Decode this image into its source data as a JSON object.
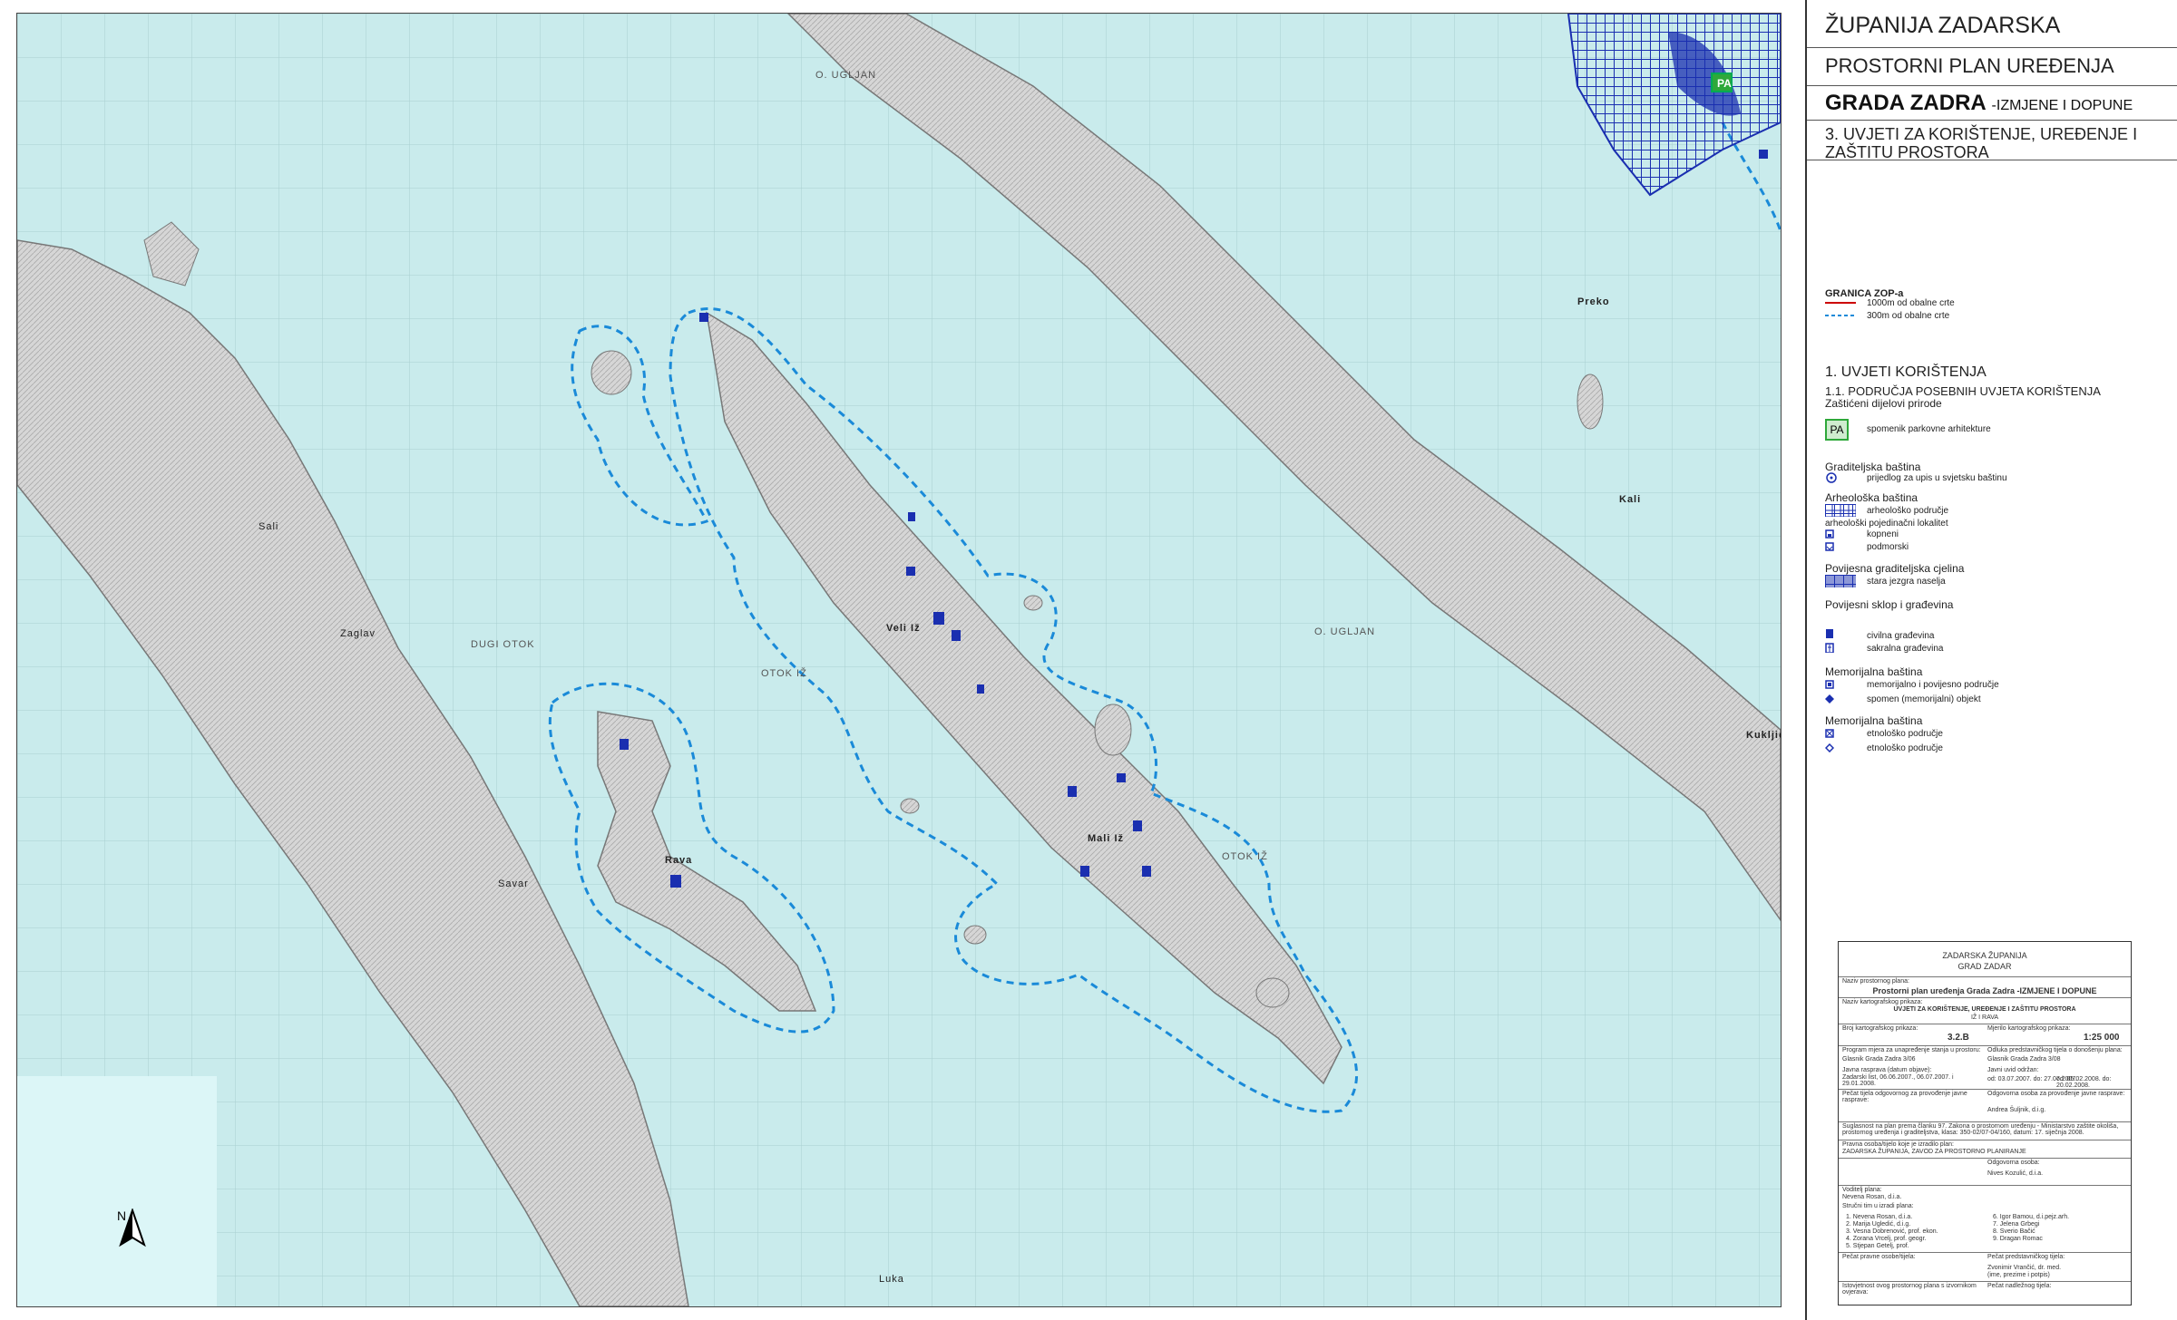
{
  "header": {
    "county": "ŽUPANIJA ZADARSKA",
    "plan": "PROSTORNI PLAN UREĐENJA",
    "city": "GRADA ZADRA",
    "suffix": "-IZMJENE I DOPUNE",
    "sheet_title": "3. UVJETI ZA KORIŠTENJE, UREĐENJE I ZAŠTITU PROSTORA"
  },
  "legend": {
    "zop_title": "GRANICA ZOP-a",
    "zop_1000": "1000m od obalne crte",
    "zop_300": "300m od obalne crte",
    "sec1": "1. UVJETI KORIŠTENJA",
    "sec11": "1.1. PODRUČJA POSEBNIH UVJETA KORIŠTENJA",
    "sec11b": "Zaštićeni dijelovi prirode",
    "pa_code": "PA",
    "pa_label": "spomenik parkovne arhitekture",
    "grad_head": "Graditeljska baština",
    "grad_item": "prijedlog za upis u svjetsku baštinu",
    "arh_head": "Arheološka baština",
    "arh_area": "arheološko područje",
    "arh_sites": "arheološki pojedinačni lokalitet",
    "arh_kop": "kopneni",
    "arh_pod": "podmorski",
    "pov_head": "Povijesna graditeljska cjelina",
    "pov_item": "stara jezgra naselja",
    "sklop_head": "Povijesni sklop i građevina",
    "civ": "civilna građevina",
    "sak": "sakralna građevina",
    "mem_head": "Memorijalna baština",
    "mem1": "memorijalno i povijesno područje",
    "mem2": "spomen (memorijalni) objekt",
    "mem2_head": "Memorijalna baština",
    "etno1": "etnološko područje",
    "etno2": "etnološko područje"
  },
  "map": {
    "labels": {
      "ugljan_n": "O. UGLJAN",
      "dugi_otok": "DUGI OTOK",
      "otok_iz": "OTOK IŽ",
      "ugljan_e": "O. UGLJAN",
      "otok_iz2": "OTOK IŽ",
      "veli_iz": "Veli Iž",
      "mali_iz": "Mali Iž",
      "preko": "Preko",
      "kali": "Kali",
      "kukljica": "Kukljica",
      "rava": "Rava",
      "savar": "Savar",
      "zaglav": "Zaglav",
      "sali": "Sali",
      "luka": "Luka"
    },
    "north": "N",
    "pa_marker": "PA"
  },
  "title_block": {
    "org1": "ZADARSKA ŽUPANIJA",
    "org2": "GRAD ZADAR",
    "plan_lbl": "Naziv prostornog plana:",
    "plan_name": "Prostorni plan uređenja Grada Zadra -IZMJENE I DOPUNE",
    "sheet_lbl": "Naziv kartografskog prikaza:",
    "sheet_name": "UVJETI ZA KORIŠTENJE, UREĐENJE I ZAŠTITU PROSTORA",
    "sheet_sub": "IŽ I RAVA",
    "num_lbl": "Broj kartografskog prikaza:",
    "num": "3.2.B",
    "scale_lbl": "Mjerilo kartografskog prikaza:",
    "scale": "1:25 000",
    "prog_lbl": "Program mjera za unapređenje stanja u prostoru:",
    "prog_val": "Glasnik Grada Zadra 3/06",
    "odluka_lbl": "Odluka predstavničkog tijela o donošenju plana:",
    "odluka_val": "Glasnik Grada Zadra 3/08",
    "javna_lbl": "Javna rasprava (datum objave):",
    "javna_val": "Zadarski list, 06.06.2007., 06.07.2007. i 29.01.2008.",
    "uvid_lbl": "Javni uvid održan:",
    "uvid_val": "od: 03.07.2007. do: 27.07.2007.",
    "uvid2": "od: 05.02.2008. do: 20.02.2008.",
    "pecat_lbl": "Pečat tijela odgovornog za provođenje javne rasprave:",
    "odg_lbl": "Odgovorna osoba za provođenje javne rasprave:",
    "odg_val": "Andrea Šuljnik, d.i.g.",
    "suglasnost": "Suglasnost na plan prema članku 97. Zakona o prostornom uređenju - Ministarstvo zaštite okoliša, prostornog uređenja i graditeljstva, klasa: 350-02/07-04/160, datum: 17. siječnja 2008.",
    "izrad_lbl": "Pravna osoba/tijelo koje je izradilo plan:",
    "izrad_val": "ZADARSKA ŽUPANIJA, ZAVOD ZA PROSTORNO PLANIRANJE",
    "odgov_lbl": "Odgovorna osoba:",
    "odgov_val": "Nives Kozulić, d.i.a.",
    "voditelj_lbl": "Voditelj plana:",
    "voditelj_val": "Nevena Rosan, d.i.a.",
    "tim_lbl": "Stručni tim u izradi plana:",
    "tim": [
      "1. Nevena Rosan, d.i.a.",
      "2. Marija Ugledić, d.i.g.",
      "3. Vesna Dobrenović, prof. ekon.",
      "4. Zorana Vrcelj, prof. geogr.",
      "5. Stjepan Getelj, prof.",
      "6. Igor Bamou, d.i.pejz.arh.",
      "7. Jelena Grbegi",
      "8. Sverio Bačić",
      "9. Dragan Romac"
    ],
    "pecat2_lbl": "Pečat pravne osobe/tijela:",
    "pecat3_lbl": "Pečat predstavničkog tijela:",
    "pred_val": "Zvonimir Vrančić, dr. med.",
    "pred_lbl": "(ime, prezime i potpis)",
    "istov_lbl": "Istovjetnost ovog prostornog plana s izvornikom ovjerava:",
    "pecat4_lbl": "Pečat nadležnog tijela:"
  }
}
